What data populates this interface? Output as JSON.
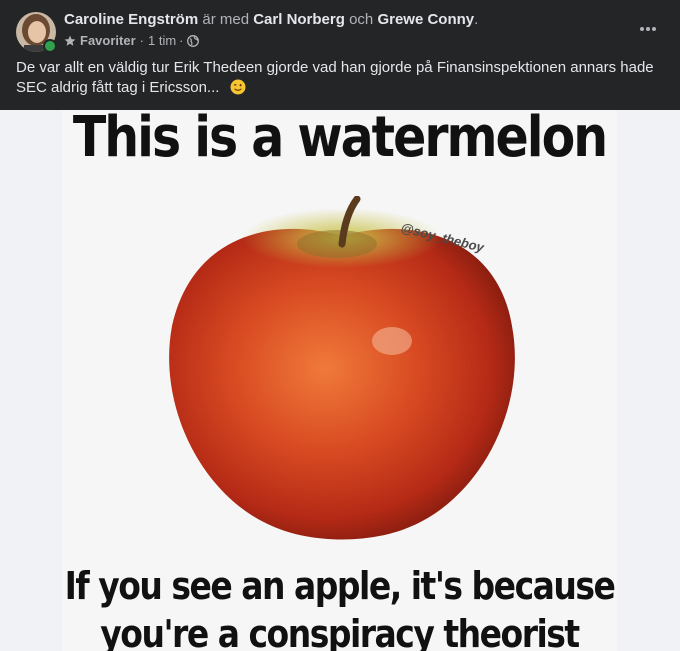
{
  "post": {
    "author": "Caroline Engström",
    "with_text": "är med",
    "tagged_1": "Carl Norberg",
    "and_text": "och",
    "tagged_2": "Grewe Conny",
    "period": ".",
    "audience_label": "Favoriter",
    "separator": "·",
    "time": "1 tim",
    "text": "De var allt en väldig tur Erik Thedeen gjorde vad han gjorde på Finansinspektionen annars hade SEC aldrig fått tag i Ericsson...",
    "more_icon": "more-options-icon",
    "emoji_icon": "wink-emoji-icon"
  },
  "meme": {
    "top_text": "This is a watermelon",
    "bottom_line_1": "If you see an apple, it's because",
    "bottom_line_2": "you're a conspiracy theorist",
    "watermark": "@soy_theboy"
  },
  "colors": {
    "header_bg": "#242526",
    "text_primary": "#e4e6eb",
    "text_secondary": "#b0b3b8",
    "online": "#31a24c"
  }
}
